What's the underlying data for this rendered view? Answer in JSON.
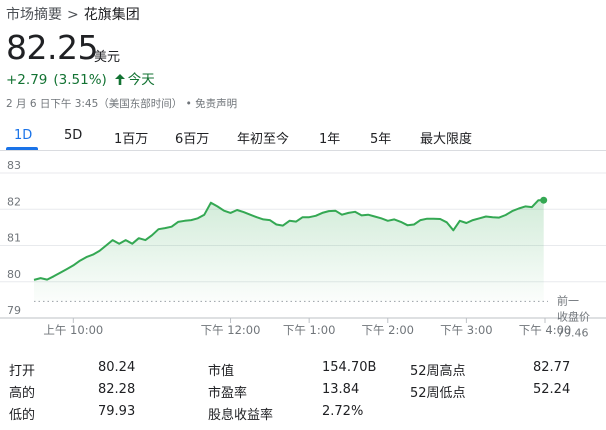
{
  "breadcrumb": {
    "parent": "市场摘要",
    "separator": ">",
    "company": "花旗集团"
  },
  "quote": {
    "price": "82.25",
    "currency": "美元",
    "change": "+2.79",
    "change_pct": "(3.51%)",
    "period": "今天",
    "timestamp": "2 月 6 日下午 3:45（美国东部时间）",
    "disclaimer": "• 免责声明"
  },
  "tabs": [
    {
      "label": "1D",
      "active": true
    },
    {
      "label": "5D"
    },
    {
      "label": "1百万"
    },
    {
      "label": "6百万"
    },
    {
      "label": "年初至今"
    },
    {
      "label": "1年"
    },
    {
      "label": "5年"
    },
    {
      "label": "最大限度"
    }
  ],
  "colors": {
    "up": "#137333",
    "line": "#34a853",
    "accent": "#1a73e8",
    "grid": "#e8eaed"
  },
  "chart_data": {
    "type": "area",
    "y_ticks": [
      "83",
      "82",
      "81",
      "80",
      "79"
    ],
    "ylim": [
      79,
      83
    ],
    "x_ticks": [
      "上午 10:00",
      "下午 12:00",
      "下午 1:00",
      "下午 2:00",
      "下午 3:00",
      "下午 4:00"
    ],
    "x_tick_minutes": [
      30,
      150,
      210,
      270,
      330,
      390
    ],
    "xlim": [
      0,
      390
    ],
    "previous_close": {
      "label_line1": "前一",
      "label_line2": "收盘价",
      "value": 79.46
    },
    "series": [
      {
        "x": [
          0,
          5,
          10,
          15,
          20,
          25,
          30,
          35,
          40,
          45,
          50,
          55,
          60,
          65,
          70,
          75,
          80,
          85,
          90,
          95,
          100,
          105,
          110,
          115,
          120,
          125,
          130,
          135,
          140,
          145,
          150,
          155,
          160,
          165,
          170,
          175,
          180,
          185,
          190,
          195,
          200,
          205,
          210,
          215,
          220,
          225,
          230,
          235,
          240,
          245,
          250,
          255,
          260,
          265,
          270,
          275,
          280,
          285,
          290,
          295,
          300,
          305,
          310,
          315,
          320,
          325,
          330,
          335,
          340,
          345,
          350,
          355,
          360,
          365,
          370,
          375,
          380,
          385,
          389
        ],
        "y": [
          80.05,
          80.1,
          80.06,
          80.15,
          80.25,
          80.35,
          80.45,
          80.58,
          80.68,
          80.75,
          80.85,
          81.0,
          81.15,
          81.05,
          81.15,
          81.05,
          81.2,
          81.15,
          81.28,
          81.45,
          81.48,
          81.52,
          81.65,
          81.68,
          81.7,
          81.75,
          81.85,
          82.18,
          82.08,
          81.96,
          81.9,
          81.98,
          81.92,
          81.85,
          81.78,
          81.72,
          81.7,
          81.58,
          81.55,
          81.68,
          81.66,
          81.78,
          81.78,
          81.82,
          81.9,
          81.95,
          81.96,
          81.85,
          81.9,
          81.93,
          81.83,
          81.85,
          81.8,
          81.75,
          81.68,
          81.72,
          81.65,
          81.56,
          81.58,
          81.7,
          81.74,
          81.74,
          81.73,
          81.64,
          81.42,
          81.68,
          81.62,
          81.7,
          81.75,
          81.8,
          81.78,
          81.77,
          81.84,
          81.95,
          82.02,
          82.08,
          82.06,
          82.25,
          82.25
        ]
      }
    ]
  },
  "stats": {
    "col1": [
      {
        "label": "打开",
        "value": "80.24"
      },
      {
        "label": "高的",
        "value": "82.28"
      },
      {
        "label": "低的",
        "value": "79.93"
      }
    ],
    "col2": [
      {
        "label": "市值",
        "value": "154.70B"
      },
      {
        "label": "市盈率",
        "value": "13.84"
      },
      {
        "label": "股息收益率",
        "value": "2.72%"
      }
    ],
    "col3": [
      {
        "label": "52周高点",
        "value": "82.77"
      },
      {
        "label": "52周低点",
        "value": "52.24"
      }
    ]
  }
}
